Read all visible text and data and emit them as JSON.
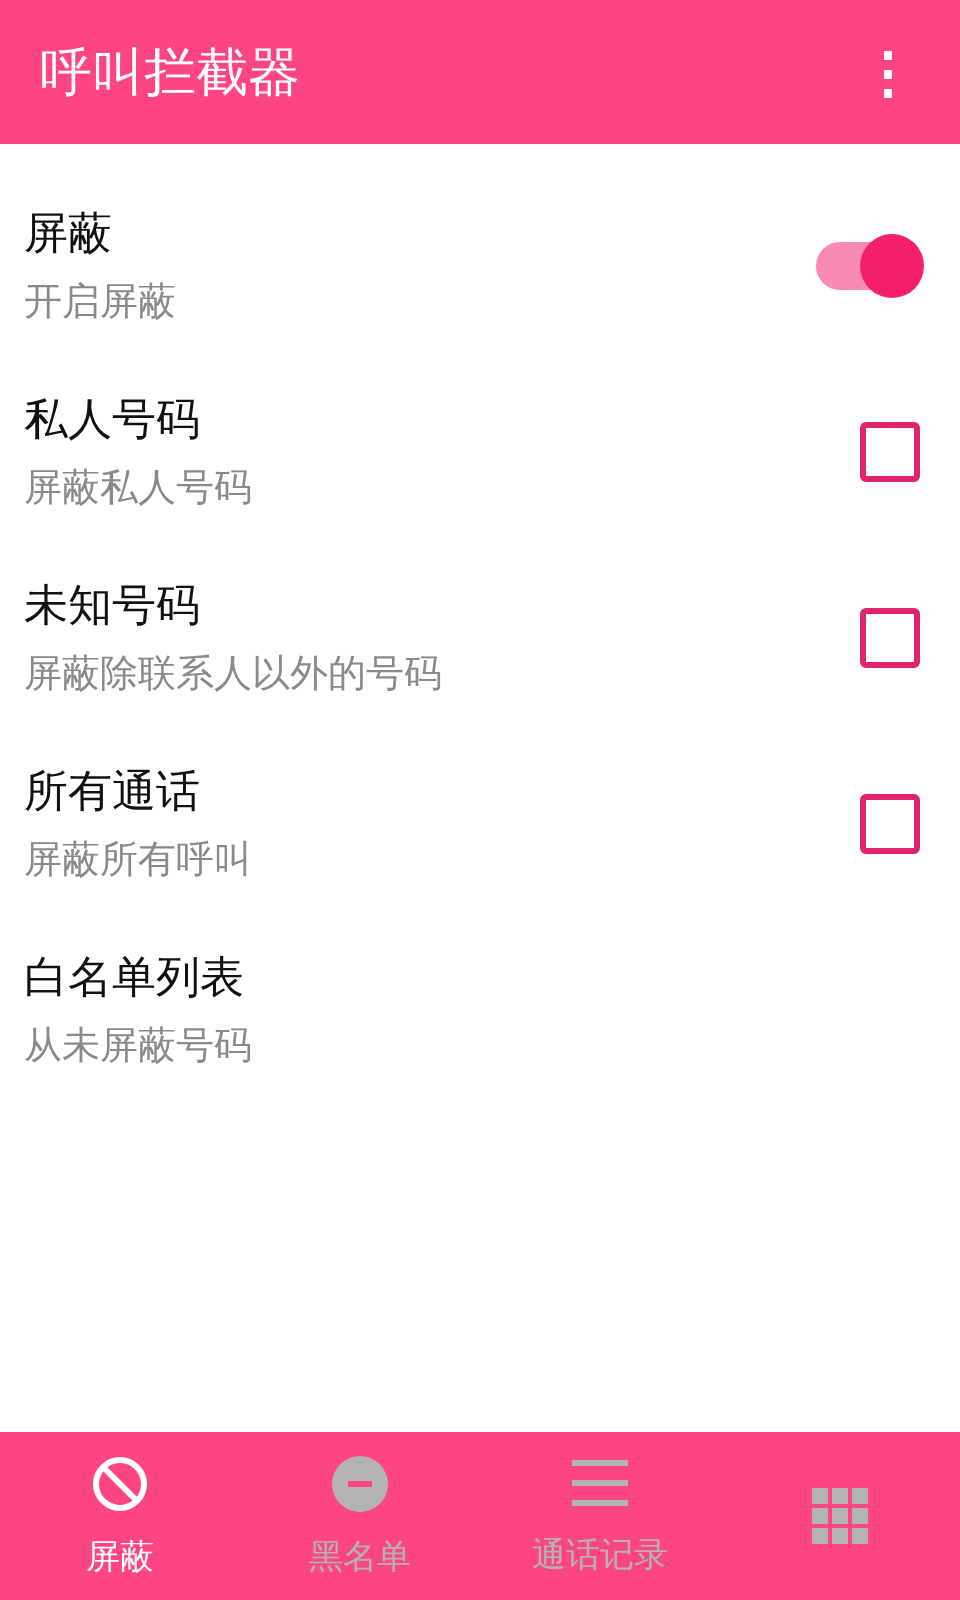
{
  "app_bar": {
    "title": "呼叫拦截器",
    "menu": "⋮"
  },
  "settings": [
    {
      "kind": "switch",
      "title": "屏蔽",
      "summary": "开启屏蔽",
      "on": true
    },
    {
      "kind": "checkbox",
      "title": "私人号码",
      "summary": "屏蔽私人号码",
      "checked": false
    },
    {
      "kind": "checkbox",
      "title": "未知号码",
      "summary": "屏蔽除联系人以外的号码",
      "checked": false
    },
    {
      "kind": "checkbox",
      "title": "所有通话",
      "summary": "屏蔽所有呼叫",
      "checked": false
    },
    {
      "kind": "plain",
      "title": "白名单列表",
      "summary": "从未屏蔽号码"
    }
  ],
  "bottom_nav": [
    {
      "kind": "block",
      "label": "屏蔽",
      "selected": true
    },
    {
      "kind": "minus",
      "label": "黑名单",
      "selected": false
    },
    {
      "kind": "list",
      "label": "通话记录",
      "selected": false
    },
    {
      "kind": "grid",
      "selected": false
    }
  ]
}
